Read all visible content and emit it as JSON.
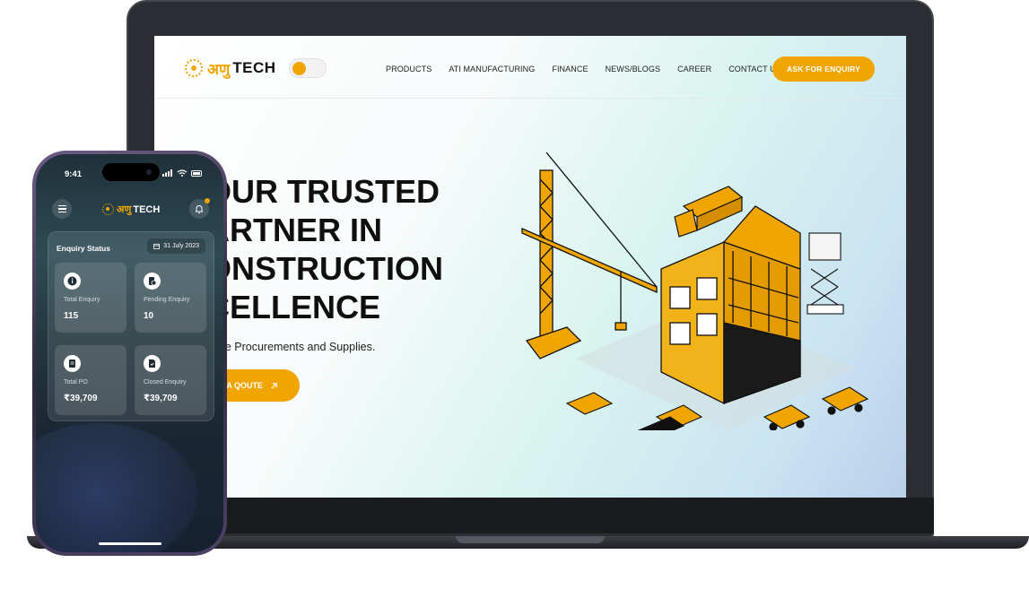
{
  "brand": {
    "name_hindi": "अणु",
    "name_latin": "TECH",
    "accent_color": "#f0a500"
  },
  "website": {
    "nav": {
      "links": [
        "PRODUCTS",
        "ATI MANUFACTURING",
        "FINANCE",
        "NEWS/BLOGS",
        "CAREER",
        "CONTACT US"
      ],
      "cta_label": "ASK FOR ENQUIRY"
    },
    "hero": {
      "title_lines": [
        "OUR TRUSTED",
        "ARTNER IN",
        "ONSTRUCTION",
        "CELLENCE"
      ],
      "subtitle": "cture Procurements and Supplies.",
      "button_label": "A QOUTE"
    },
    "illustration": "isometric-construction-site-with-crane-trucks-and-building"
  },
  "phone": {
    "status_time": "9:41",
    "header": {
      "menu_icon": "menu-icon",
      "bell_icon": "bell-icon"
    },
    "enquiry_status": {
      "title": "Enquiry Status",
      "date": "31 July 2023",
      "cards": [
        {
          "label": "Total Enquiry",
          "value": "115",
          "icon": "info-icon"
        },
        {
          "label": "Pending Enquiry",
          "value": "10",
          "icon": "pending-icon"
        },
        {
          "label": "Total PO",
          "value": "₹39,709",
          "icon": "document-icon"
        },
        {
          "label": "Closed Enquiry",
          "value": "₹39,709",
          "icon": "file-check-icon"
        }
      ]
    }
  }
}
